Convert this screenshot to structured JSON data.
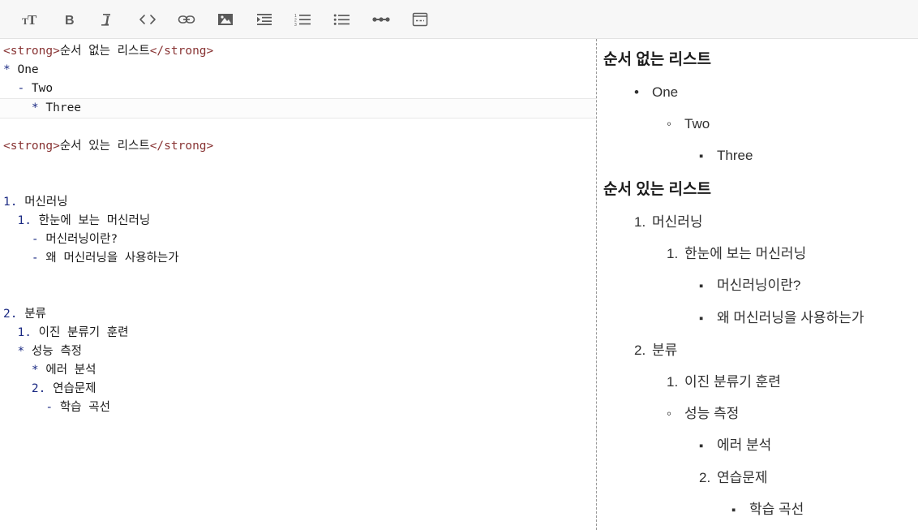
{
  "toolbar": {
    "buttons": [
      {
        "name": "text-size-icon",
        "label": "Text size"
      },
      {
        "name": "bold-icon",
        "label": "Bold"
      },
      {
        "name": "italic-icon",
        "label": "Italic"
      },
      {
        "name": "code-icon",
        "label": "Code"
      },
      {
        "name": "link-icon",
        "label": "Link"
      },
      {
        "name": "image-icon",
        "label": "Image"
      },
      {
        "name": "blockquote-icon",
        "label": "Blockquote"
      },
      {
        "name": "ordered-list-icon",
        "label": "Ordered list"
      },
      {
        "name": "unordered-list-icon",
        "label": "Unordered list"
      },
      {
        "name": "horizontal-rule-icon",
        "label": "Horizontal rule"
      },
      {
        "name": "page-break-icon",
        "label": "Page break"
      }
    ]
  },
  "colors": {
    "toolbar_bg": "#f7f7f7",
    "toolbar_border": "#e2e2e2",
    "tag": "#883333",
    "marker": "#1b2a83",
    "text": "#1b1b1b",
    "divider": "#999999",
    "active_line_bg": "#fcfcfc",
    "active_line_border": "#e8e8e8"
  },
  "editor": {
    "lines": [
      {
        "id": "l1",
        "active": false,
        "blank": false,
        "segments": [
          {
            "type": "tag",
            "text": "<strong>"
          },
          {
            "type": "text",
            "text": "순서 없는 리스트"
          },
          {
            "type": "tag",
            "text": "</strong>"
          }
        ]
      },
      {
        "id": "l2",
        "active": false,
        "blank": false,
        "segments": [
          {
            "type": "marker",
            "text": "*"
          },
          {
            "type": "text",
            "text": " One"
          }
        ]
      },
      {
        "id": "l3",
        "active": false,
        "blank": false,
        "segments": [
          {
            "type": "marker",
            "text": "  -"
          },
          {
            "type": "text",
            "text": " Two"
          }
        ]
      },
      {
        "id": "l4",
        "active": true,
        "blank": false,
        "segments": [
          {
            "type": "marker",
            "text": "    *"
          },
          {
            "type": "text",
            "text": " Three"
          }
        ]
      },
      {
        "id": "l5",
        "active": false,
        "blank": true,
        "segments": [
          {
            "type": "text",
            "text": " "
          }
        ]
      },
      {
        "id": "l6",
        "active": false,
        "blank": false,
        "segments": [
          {
            "type": "tag",
            "text": "<strong>"
          },
          {
            "type": "text",
            "text": "순서 있는 리스트"
          },
          {
            "type": "tag",
            "text": "</strong>"
          }
        ]
      },
      {
        "id": "l7",
        "active": false,
        "blank": true,
        "segments": [
          {
            "type": "text",
            "text": " "
          }
        ]
      },
      {
        "id": "l8",
        "active": false,
        "blank": true,
        "segments": [
          {
            "type": "text",
            "text": " "
          }
        ]
      },
      {
        "id": "l9",
        "active": false,
        "blank": false,
        "segments": [
          {
            "type": "marker",
            "text": "1."
          },
          {
            "type": "text",
            "text": " 머신러닝"
          }
        ]
      },
      {
        "id": "l10",
        "active": false,
        "blank": false,
        "segments": [
          {
            "type": "marker",
            "text": "  1."
          },
          {
            "type": "text",
            "text": " 한눈에 보는 머신러닝"
          }
        ]
      },
      {
        "id": "l11",
        "active": false,
        "blank": false,
        "segments": [
          {
            "type": "marker",
            "text": "    -"
          },
          {
            "type": "text",
            "text": " 머신러닝이란?"
          }
        ]
      },
      {
        "id": "l12",
        "active": false,
        "blank": false,
        "segments": [
          {
            "type": "marker",
            "text": "    -"
          },
          {
            "type": "text",
            "text": " 왜 머신러닝을 사용하는가"
          }
        ]
      },
      {
        "id": "l13",
        "active": false,
        "blank": true,
        "segments": [
          {
            "type": "text",
            "text": " "
          }
        ]
      },
      {
        "id": "l14",
        "active": false,
        "blank": true,
        "segments": [
          {
            "type": "text",
            "text": " "
          }
        ]
      },
      {
        "id": "l15",
        "active": false,
        "blank": false,
        "segments": [
          {
            "type": "marker",
            "text": "2."
          },
          {
            "type": "text",
            "text": " 분류"
          }
        ]
      },
      {
        "id": "l16",
        "active": false,
        "blank": false,
        "segments": [
          {
            "type": "marker",
            "text": "  1."
          },
          {
            "type": "text",
            "text": " 이진 분류기 훈련"
          }
        ]
      },
      {
        "id": "l17",
        "active": false,
        "blank": false,
        "segments": [
          {
            "type": "marker",
            "text": "  *"
          },
          {
            "type": "text",
            "text": " 성능 측정"
          }
        ]
      },
      {
        "id": "l18",
        "active": false,
        "blank": false,
        "segments": [
          {
            "type": "marker",
            "text": "    *"
          },
          {
            "type": "text",
            "text": " 에러 분석"
          }
        ]
      },
      {
        "id": "l19",
        "active": false,
        "blank": false,
        "segments": [
          {
            "type": "marker",
            "text": "    2."
          },
          {
            "type": "text",
            "text": " 연습문제"
          }
        ]
      },
      {
        "id": "l20",
        "active": false,
        "blank": false,
        "segments": [
          {
            "type": "marker",
            "text": "      -"
          },
          {
            "type": "text",
            "text": " 학습 곡선"
          }
        ]
      }
    ]
  },
  "preview": {
    "heading_1": "순서 없는 리스트",
    "heading_2": "순서 있는 리스트",
    "unordered_items": [
      {
        "id": "u1",
        "marker_type": "disc",
        "marker_text": "",
        "indent": 1,
        "text": "One"
      },
      {
        "id": "u2",
        "marker_type": "circle",
        "marker_text": "",
        "indent": 2,
        "text": "Two"
      },
      {
        "id": "u3",
        "marker_type": "square",
        "marker_text": "",
        "indent": 3,
        "text": "Three"
      }
    ],
    "ordered_items": [
      {
        "id": "o1",
        "marker_type": "num",
        "marker_text": "1.",
        "indent": 1,
        "text": "머신러닝"
      },
      {
        "id": "o2",
        "marker_type": "num",
        "marker_text": "1.",
        "indent": 2,
        "text": "한눈에 보는 머신러닝"
      },
      {
        "id": "o3",
        "marker_type": "square",
        "marker_text": "",
        "indent": 3,
        "text": "머신러닝이란?"
      },
      {
        "id": "o4",
        "marker_type": "square",
        "marker_text": "",
        "indent": 3,
        "text": "왜 머신러닝을 사용하는가"
      },
      {
        "id": "o5",
        "marker_type": "num",
        "marker_text": "2.",
        "indent": 1,
        "text": "분류"
      },
      {
        "id": "o6",
        "marker_type": "num",
        "marker_text": "1.",
        "indent": 2,
        "text": "이진 분류기 훈련"
      },
      {
        "id": "o7",
        "marker_type": "circle",
        "marker_text": "",
        "indent": 2,
        "text": "성능 측정"
      },
      {
        "id": "o8",
        "marker_type": "square",
        "marker_text": "",
        "indent": 3,
        "text": "에러 분석"
      },
      {
        "id": "o9",
        "marker_type": "num",
        "marker_text": "2.",
        "indent": 3,
        "text": "연습문제"
      },
      {
        "id": "o10",
        "marker_type": "square",
        "marker_text": "",
        "indent": 4,
        "text": "학습 곡선"
      }
    ]
  }
}
